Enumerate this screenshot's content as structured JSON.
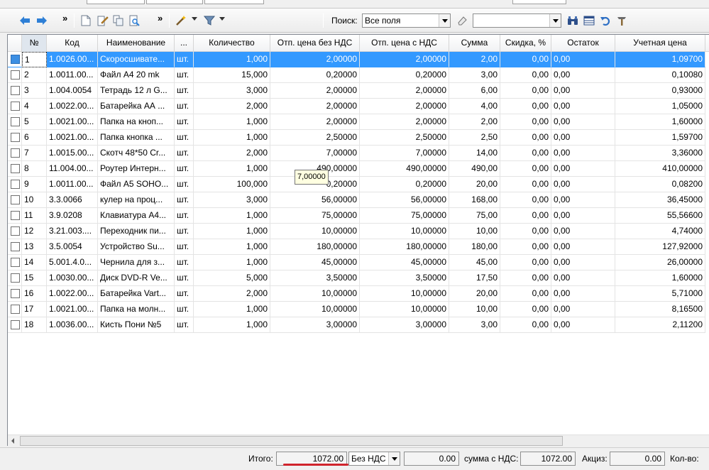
{
  "toolbar": {
    "search_label": "Поиск:",
    "search_field_value": "Все поля",
    "search_text_value": "",
    "more_glyph": "»",
    "icons": [
      "arrow-left-icon",
      "arrow-right-icon",
      "new-document-icon",
      "edit-document-icon",
      "copy-document-icon",
      "find-document-icon",
      "wand-icon",
      "filter-icon",
      "eraser-icon",
      "binoculars-icon",
      "grid-icon",
      "undo-icon",
      "tools-icon"
    ]
  },
  "grid": {
    "headers": [
      "№",
      "Код",
      "Наименование",
      "...",
      "Количество",
      "Отп. цена без НДС",
      "Отп. цена с НДС",
      "Сумма",
      "Скидка, %",
      "Остаток",
      "Учетная цена"
    ],
    "selected_row": 0,
    "rows": [
      [
        "1",
        "1.0026.00...",
        "Скоросшивате...",
        "шт.",
        "1,000",
        "2,00000",
        "2,00000",
        "2,00",
        "0,00",
        "0,00",
        "1,09700"
      ],
      [
        "2",
        "1.0011.00...",
        "Файл А4 20 mk",
        "шт.",
        "15,000",
        "0,20000",
        "0,20000",
        "3,00",
        "0,00",
        "0,00",
        "0,10080"
      ],
      [
        "3",
        "1.004.0054",
        "Тетрадь 12 л G...",
        "шт.",
        "3,000",
        "2,00000",
        "2,00000",
        "6,00",
        "0,00",
        "0,00",
        "0,93000"
      ],
      [
        "4",
        "1.0022.00...",
        "Батарейка АА ...",
        "шт.",
        "2,000",
        "2,00000",
        "2,00000",
        "4,00",
        "0,00",
        "0,00",
        "1,05000"
      ],
      [
        "5",
        "1.0021.00...",
        "Папка на кноп...",
        "шт.",
        "1,000",
        "2,00000",
        "2,00000",
        "2,00",
        "0,00",
        "0,00",
        "1,60000"
      ],
      [
        "6",
        "1.0021.00...",
        "Папка кнопка ...",
        "шт.",
        "1,000",
        "2,50000",
        "2,50000",
        "2,50",
        "0,00",
        "0,00",
        "1,59700"
      ],
      [
        "7",
        "1.0015.00...",
        "Скотч 48*50 Cr...",
        "шт.",
        "2,000",
        "7,00000",
        "7,00000",
        "14,00",
        "0,00",
        "0,00",
        "3,36000"
      ],
      [
        "8",
        "11.004.00...",
        "Роутер Интерн...",
        "шт.",
        "1,000",
        "490,00000",
        "490,00000",
        "490,00",
        "0,00",
        "0,00",
        "410,00000"
      ],
      [
        "9",
        "1.0011.00...",
        "Файл А5 SOHO...",
        "шт.",
        "100,000",
        "0,20000",
        "0,20000",
        "20,00",
        "0,00",
        "0,00",
        "0,08200"
      ],
      [
        "10",
        "3.3.0066",
        "кулер на проц...",
        "шт.",
        "3,000",
        "56,00000",
        "56,00000",
        "168,00",
        "0,00",
        "0,00",
        "36,45000"
      ],
      [
        "11",
        "3.9.0208",
        "Клавиатура А4...",
        "шт.",
        "1,000",
        "75,00000",
        "75,00000",
        "75,00",
        "0,00",
        "0,00",
        "55,56600"
      ],
      [
        "12",
        "3.21.003....",
        "Переходник пи...",
        "шт.",
        "1,000",
        "10,00000",
        "10,00000",
        "10,00",
        "0,00",
        "0,00",
        "4,74000"
      ],
      [
        "13",
        "3.5.0054",
        "Устройство Su...",
        "шт.",
        "1,000",
        "180,00000",
        "180,00000",
        "180,00",
        "0,00",
        "0,00",
        "127,92000"
      ],
      [
        "14",
        "5.001.4.0...",
        "Чернила для з...",
        "шт.",
        "1,000",
        "45,00000",
        "45,00000",
        "45,00",
        "0,00",
        "0,00",
        "26,00000"
      ],
      [
        "15",
        "1.0030.00...",
        "Диск DVD-R Ve...",
        "шт.",
        "5,000",
        "3,50000",
        "3,50000",
        "17,50",
        "0,00",
        "0,00",
        "1,60000"
      ],
      [
        "16",
        "1.0022.00...",
        "Батарейка Vart...",
        "шт.",
        "2,000",
        "10,00000",
        "10,00000",
        "20,00",
        "0,00",
        "0,00",
        "5,71000"
      ],
      [
        "17",
        "1.0021.00...",
        "Папка на молн...",
        "шт.",
        "1,000",
        "10,00000",
        "10,00000",
        "10,00",
        "0,00",
        "0,00",
        "8,16500"
      ],
      [
        "18",
        "1.0036.00...",
        "Кисть Пони №5",
        "шт.",
        "1,000",
        "3,00000",
        "3,00000",
        "3,00",
        "0,00",
        "0,00",
        "2,11200"
      ]
    ],
    "tooltip": "7,00000"
  },
  "footer": {
    "total_label": "Итого:",
    "total_value": "1072.00",
    "vat_mode": "Без НДС",
    "vat_value": "0.00",
    "sum_with_vat_label": "сумма с НДС:",
    "sum_with_vat_value": "1072.00",
    "excise_label": "Акциз:",
    "excise_value": "0.00",
    "count_label": "Кол-во:"
  },
  "colors": {
    "selection": "#3399ff",
    "accent_red": "#d0242c",
    "tooltip_bg": "#ffffe1"
  }
}
